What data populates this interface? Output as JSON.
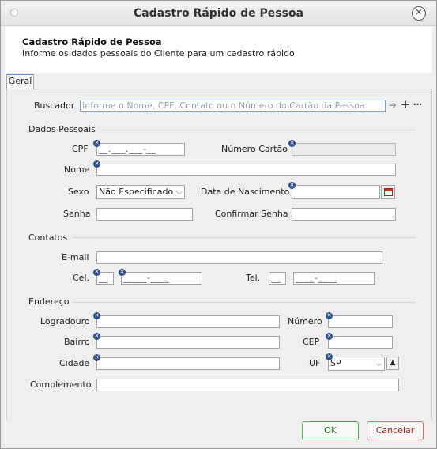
{
  "window": {
    "title": "Cadastro Rápido de Pessoa",
    "close_glyph": "✕"
  },
  "header": {
    "title": "Cadastro Rápido de Pessoa",
    "subtitle": "Informe os dados pessoais do Cliente para um cadastro rápido"
  },
  "tabs": [
    {
      "label": "Geral",
      "active": true
    }
  ],
  "search": {
    "label": "Buscador",
    "placeholder": "Informe o Nome, CPF, Contato ou o Número do Cartão da Pessoa",
    "go_glyph": "➔",
    "add_glyph": "+",
    "more_glyph": "•••"
  },
  "personal": {
    "section_title": "Dados Pessoais",
    "cpf_label": "CPF",
    "cpf_value": "__.___.___-__",
    "card_label": "Número Cartão",
    "card_value": "",
    "name_label": "Nome",
    "name_value": "",
    "sex_label": "Sexo",
    "sex_value": "Não Especificado",
    "birth_label": "Data de Nascimento",
    "birth_value": "",
    "password_label": "Senha",
    "password_value": "",
    "confirm_label": "Confirmar Senha",
    "confirm_value": ""
  },
  "contacts": {
    "section_title": "Contatos",
    "email_label": "E-mail",
    "email_value": "",
    "cel_label": "Cel.",
    "cel_ddd": "__",
    "cel_number": "_____-____",
    "tel_label": "Tel.",
    "tel_ddd": "__",
    "tel_number": "____-____"
  },
  "address": {
    "section_title": "Endereço",
    "street_label": "Logradouro",
    "street_value": "",
    "number_label": "Número",
    "number_value": "",
    "district_label": "Bairro",
    "district_value": "",
    "cep_label": "CEP",
    "cep_value": "",
    "city_label": "Cidade",
    "city_value": "",
    "uf_label": "UF",
    "uf_value": "SP",
    "complement_label": "Complemento",
    "complement_value": ""
  },
  "buttons": {
    "ok": "OK",
    "cancel": "Cancelar"
  },
  "colors": {
    "required_marker": "#2e4f8a",
    "ok_border": "#4caf50",
    "cancel_border": "#dd6666"
  }
}
